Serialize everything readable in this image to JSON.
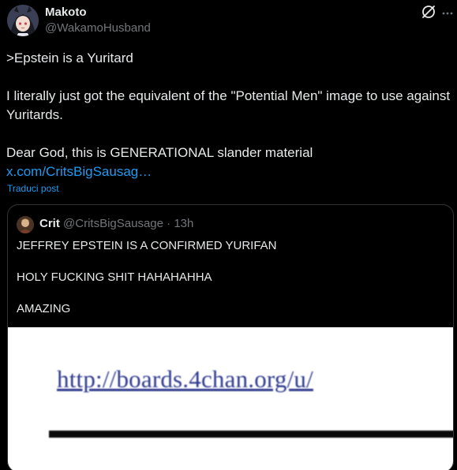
{
  "author": {
    "display_name": "Makoto",
    "handle": "@WakamoHusband",
    "avatar_icon": "anime-avatar"
  },
  "post": {
    "lines": [
      ">Epstein is a Yuritard",
      "",
      "I literally just got the equivalent of the \"Potential Men\" image to use against Yuritards.",
      "",
      "Dear God, this is GENERATIONAL slander material"
    ],
    "link_text": "x.com/CritsBigSausag…",
    "translate_label": "Traduci post"
  },
  "quoted_post": {
    "display_name": "Crit",
    "handle": "@CritsBigSausage",
    "separator": "·",
    "time": "13h",
    "lines": [
      "JEFFREY EPSTEIN IS A CONFIRMED YURIFAN",
      "",
      "HOLY FUCKING SHIT HAHAHAHHA",
      "",
      "AMAZING"
    ],
    "media_text": "http://boards.4chan.org/u/"
  },
  "colors": {
    "background": "#000000",
    "text": "#e7e9ea",
    "secondary": "#71767b",
    "link": "#1d9bf0",
    "border": "#2f3336"
  },
  "icons": {
    "top_right": "grok-icon",
    "menu": "more-icon"
  }
}
